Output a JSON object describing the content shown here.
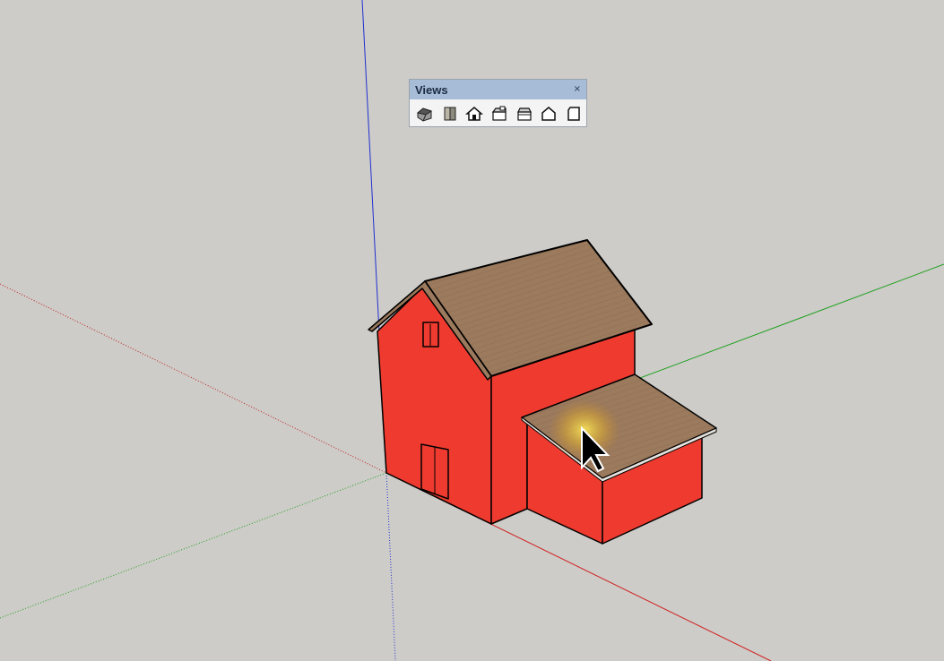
{
  "toolbar": {
    "title": "Views",
    "close_glyph": "×",
    "buttons": [
      {
        "name": "iso-view-button",
        "icon": "iso-house-icon"
      },
      {
        "name": "top-view-button",
        "icon": "top-view-icon"
      },
      {
        "name": "front-view-button",
        "icon": "front-view-icon"
      },
      {
        "name": "right-view-button",
        "icon": "right-view-icon"
      },
      {
        "name": "back-view-button",
        "icon": "back-view-icon"
      },
      {
        "name": "left-view-button",
        "icon": "left-view-icon"
      },
      {
        "name": "bottom-view-button",
        "icon": "bottom-view-icon"
      }
    ]
  },
  "scene": {
    "wall_color": "#ef3b2f",
    "roof_color": "#9b7a5d",
    "background_color": "#cdccc8",
    "axis_colors": {
      "red": "#d02020",
      "green": "#20a020",
      "blue": "#2030d0"
    }
  }
}
